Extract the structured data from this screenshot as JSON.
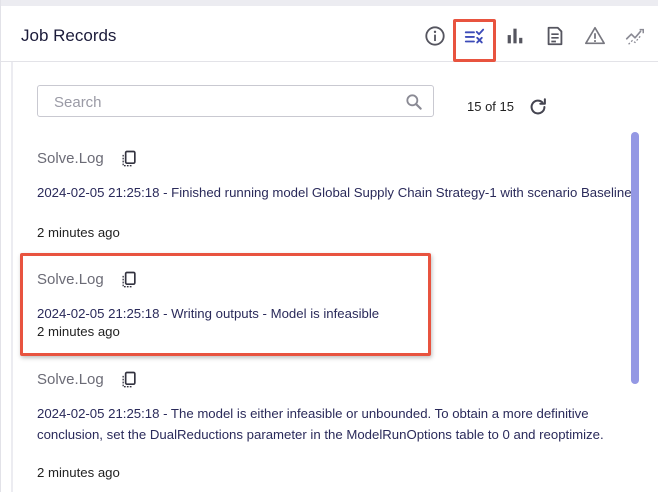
{
  "header": {
    "title": "Job Records",
    "toolbar_icons": [
      "info-icon",
      "filter-check-icon",
      "bar-chart-icon",
      "document-icon",
      "warning-icon",
      "trend-icon"
    ],
    "active_icon": "filter-check-icon"
  },
  "search": {
    "placeholder": "Search",
    "value": ""
  },
  "count_label": "15 of 15",
  "records": [
    {
      "name": "Solve.Log",
      "message": "2024-02-05 21:25:18 - Finished running model Global Supply Chain Strategy-1 with scenario Baseline",
      "time": "2 minutes ago"
    },
    {
      "name": "Solve.Log",
      "message": "2024-02-05 21:25:18 - Writing outputs - Model is infeasible",
      "time": "2 minutes ago"
    },
    {
      "name": "Solve.Log",
      "message": "2024-02-05 21:25:18 - The model is either infeasible or unbounded. To obtain a more definitive conclusion, set the DualReductions parameter in the ModelRunOptions table to 0 and reoptimize.",
      "time": "2 minutes ago"
    }
  ],
  "colors": {
    "highlight": "#e8533f",
    "scrollbar": "#9498e4",
    "active_icon": "#3c4bb8",
    "text_dark": "#1b1b3a"
  }
}
